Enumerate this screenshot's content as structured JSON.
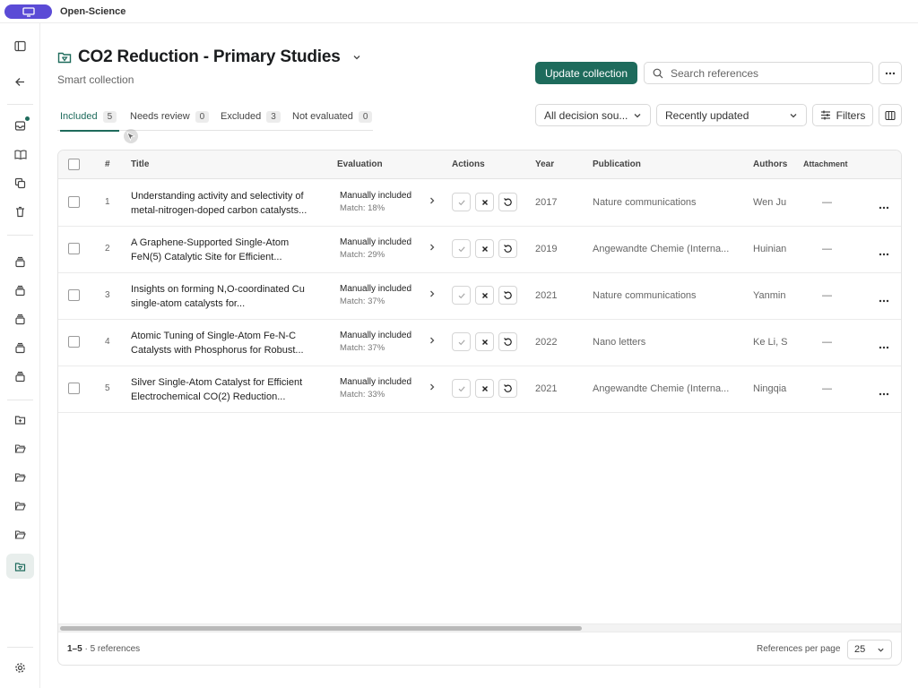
{
  "app": {
    "name": "Open-Science"
  },
  "header": {
    "title": "CO2 Reduction - Primary Studies",
    "subtitle": "Smart collection",
    "update_label": "Update collection",
    "search_placeholder": "Search references"
  },
  "tabs": [
    {
      "label": "Included",
      "count": "5",
      "active": true
    },
    {
      "label": "Needs review",
      "count": "0"
    },
    {
      "label": "Excluded",
      "count": "3"
    },
    {
      "label": "Not evaluated",
      "count": "0"
    }
  ],
  "toolbar": {
    "decision_source": "All decision sou...",
    "sort": "Recently updated",
    "filters_label": "Filters"
  },
  "table": {
    "columns": [
      "#",
      "Title",
      "Evaluation",
      "Actions",
      "Year",
      "Publication",
      "Authors",
      "Attachment"
    ],
    "rows": [
      {
        "num": "1",
        "title1": "Understanding activity and selectivity of",
        "title2": "metal-nitrogen-doped carbon catalysts...",
        "eval": "Manually included",
        "match": "Match: 18%",
        "year": "2017",
        "publication": "Nature communications",
        "authors": "Wen Ju",
        "attachment": "—"
      },
      {
        "num": "2",
        "title1": "A Graphene-Supported Single-Atom",
        "title2": "FeN(5) Catalytic Site for Efficient...",
        "eval": "Manually included",
        "match": "Match: 29%",
        "year": "2019",
        "publication": "Angewandte Chemie (Interna...",
        "authors": "Huinian",
        "attachment": "—"
      },
      {
        "num": "3",
        "title1": "Insights on forming N,O-coordinated Cu",
        "title2": "single-atom catalysts for...",
        "eval": "Manually included",
        "match": "Match: 37%",
        "year": "2021",
        "publication": "Nature communications",
        "authors": "Yanmin",
        "attachment": "—"
      },
      {
        "num": "4",
        "title1": "Atomic Tuning of Single-Atom Fe-N-C",
        "title2": "Catalysts with Phosphorus for Robust...",
        "eval": "Manually included",
        "match": "Match: 37%",
        "year": "2022",
        "publication": "Nano letters",
        "authors": "Ke Li, S",
        "attachment": "—"
      },
      {
        "num": "5",
        "title1": "Silver Single-Atom Catalyst for Efficient",
        "title2": "Electrochemical CO(2) Reduction...",
        "eval": "Manually included",
        "match": "Match: 33%",
        "year": "2021",
        "publication": "Angewandte Chemie (Interna...",
        "authors": "Ningqia",
        "attachment": "—"
      }
    ]
  },
  "footer": {
    "range": "1–5",
    "count_text": " · 5 references",
    "per_page_label": "References per page",
    "per_page_value": "25"
  },
  "colors": {
    "accent": "#1e6b5c",
    "brand": "#5b4bd6"
  }
}
